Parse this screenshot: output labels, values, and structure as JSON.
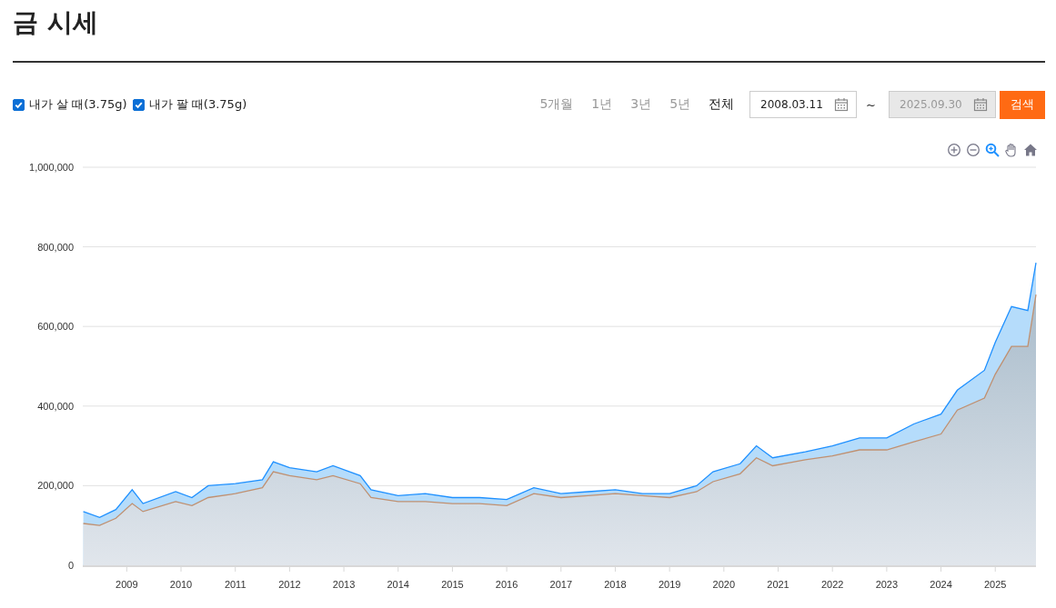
{
  "title": "금 시세",
  "series_toggles": [
    {
      "checked": true
    },
    {
      "checked": true
    }
  ],
  "range_tabs": [
    {
      "label": "5개월",
      "selected": false
    },
    {
      "label": "1년",
      "selected": false
    },
    {
      "label": "3년",
      "selected": false
    },
    {
      "label": "5년",
      "selected": false
    },
    {
      "label": "전체",
      "selected": true
    }
  ],
  "date_from": {
    "value": "2008.03.11",
    "disabled": false
  },
  "date_separator": "~",
  "date_to": {
    "value": "2025.09.30",
    "disabled": true
  },
  "search_button": "검색",
  "chart_tools": [
    {
      "kind": "zoom-in",
      "selected": false
    },
    {
      "kind": "zoom-out",
      "selected": false
    },
    {
      "kind": "magnify",
      "selected": true
    },
    {
      "kind": "pan",
      "selected": false
    },
    {
      "kind": "home",
      "selected": false
    }
  ],
  "chart_data": {
    "type": "area",
    "x": [
      2008.2,
      2008.5,
      2008.8,
      2009.1,
      2009.3,
      2009.9,
      2010.2,
      2010.5,
      2011.0,
      2011.5,
      2011.7,
      2012.0,
      2012.5,
      2012.8,
      2013.3,
      2013.5,
      2014.0,
      2014.5,
      2015.0,
      2015.5,
      2016.0,
      2016.5,
      2017.0,
      2017.5,
      2018.0,
      2018.5,
      2019.0,
      2019.5,
      2019.8,
      2020.3,
      2020.6,
      2020.9,
      2021.5,
      2022.0,
      2022.5,
      2023.0,
      2023.5,
      2024.0,
      2024.3,
      2024.8,
      2025.0,
      2025.3,
      2025.6,
      2025.75
    ],
    "series": [
      {
        "name": "내가 살 때(3.75g)",
        "color": "#1e90ff",
        "values": [
          135000,
          120000,
          140000,
          190000,
          155000,
          185000,
          170000,
          200000,
          205000,
          215000,
          260000,
          245000,
          235000,
          250000,
          225000,
          190000,
          175000,
          180000,
          170000,
          170000,
          165000,
          195000,
          180000,
          185000,
          190000,
          180000,
          180000,
          200000,
          235000,
          255000,
          300000,
          270000,
          285000,
          300000,
          320000,
          320000,
          355000,
          380000,
          440000,
          490000,
          560000,
          650000,
          640000,
          760000
        ]
      },
      {
        "name": "내가 팔 때(3.75g)",
        "color": "#c09070",
        "values": [
          105000,
          100000,
          118000,
          155000,
          135000,
          160000,
          150000,
          170000,
          180000,
          195000,
          235000,
          225000,
          215000,
          225000,
          205000,
          170000,
          160000,
          160000,
          155000,
          155000,
          150000,
          180000,
          170000,
          175000,
          180000,
          175000,
          170000,
          185000,
          210000,
          230000,
          270000,
          250000,
          265000,
          275000,
          290000,
          290000,
          310000,
          330000,
          390000,
          420000,
          480000,
          550000,
          550000,
          680000
        ]
      }
    ],
    "grid": true,
    "xlim": [
      2008.19,
      2025.75
    ],
    "ylim": [
      0,
      1000000
    ],
    "xticks": [
      2009,
      2010,
      2011,
      2012,
      2013,
      2014,
      2015,
      2016,
      2017,
      2018,
      2019,
      2020,
      2021,
      2022,
      2023,
      2024,
      2025
    ],
    "yticks": [
      {
        "value": 0,
        "label": "0"
      },
      {
        "value": 200000,
        "label": "200,000"
      },
      {
        "value": 400000,
        "label": "400,000"
      },
      {
        "value": 600000,
        "label": "600,000"
      },
      {
        "value": 800000,
        "label": "800,000"
      },
      {
        "value": 1000000,
        "label": "1,000,000"
      }
    ]
  }
}
